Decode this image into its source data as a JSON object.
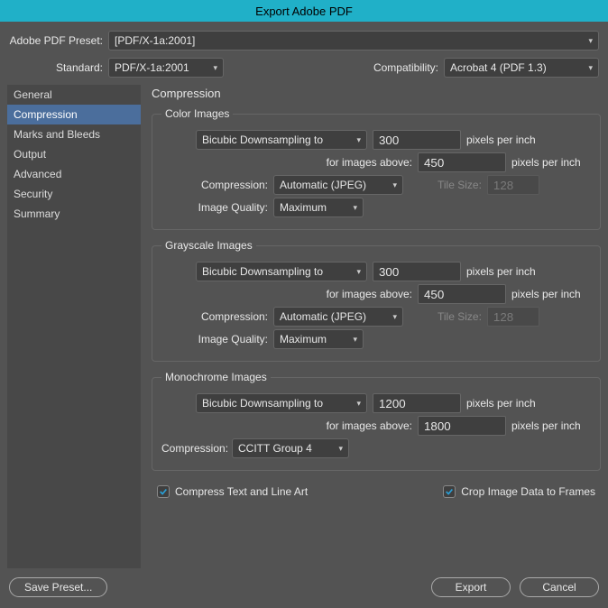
{
  "title": "Export Adobe PDF",
  "preset_label": "Adobe PDF Preset:",
  "preset_value": "[PDF/X-1a:2001]",
  "standard_label": "Standard:",
  "standard_value": "PDF/X-1a:2001",
  "compat_label": "Compatibility:",
  "compat_value": "Acrobat 4 (PDF 1.3)",
  "sidebar": {
    "items": [
      "General",
      "Compression",
      "Marks and Bleeds",
      "Output",
      "Advanced",
      "Security",
      "Summary"
    ],
    "selected": "Compression"
  },
  "panel_title": "Compression",
  "labels": {
    "for_images_above": "for images above:",
    "ppi": "pixels per inch",
    "compression": "Compression:",
    "image_quality": "Image Quality:",
    "tile_size": "Tile Size:"
  },
  "color": {
    "legend": "Color Images",
    "method": "Bicubic Downsampling to",
    "target": "300",
    "above": "450",
    "compression": "Automatic (JPEG)",
    "quality": "Maximum",
    "tile": "128"
  },
  "gray": {
    "legend": "Grayscale Images",
    "method": "Bicubic Downsampling to",
    "target": "300",
    "above": "450",
    "compression": "Automatic (JPEG)",
    "quality": "Maximum",
    "tile": "128"
  },
  "mono": {
    "legend": "Monochrome Images",
    "method": "Bicubic Downsampling to",
    "target": "1200",
    "above": "1800",
    "compression": "CCITT Group 4"
  },
  "compress_text": "Compress Text and Line Art",
  "crop_image": "Crop Image Data to Frames",
  "buttons": {
    "save_preset": "Save Preset...",
    "export": "Export",
    "cancel": "Cancel"
  }
}
